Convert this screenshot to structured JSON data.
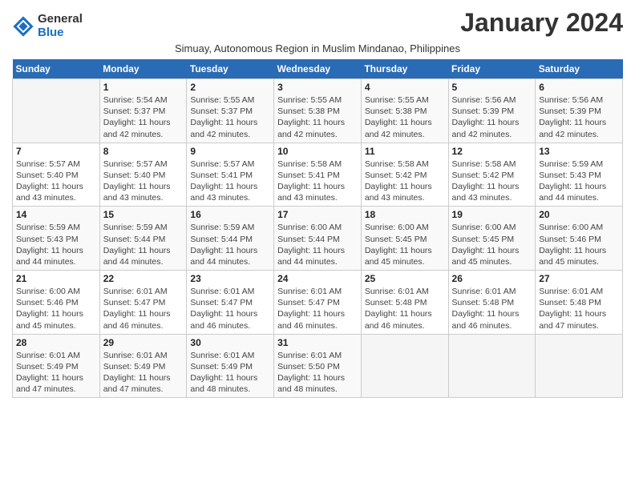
{
  "logo": {
    "general": "General",
    "blue": "Blue"
  },
  "title": "January 2024",
  "subtitle": "Simuay, Autonomous Region in Muslim Mindanao, Philippines",
  "header_days": [
    "Sunday",
    "Monday",
    "Tuesday",
    "Wednesday",
    "Thursday",
    "Friday",
    "Saturday"
  ],
  "weeks": [
    [
      {
        "day": "",
        "info": ""
      },
      {
        "day": "1",
        "info": "Sunrise: 5:54 AM\nSunset: 5:37 PM\nDaylight: 11 hours\nand 42 minutes."
      },
      {
        "day": "2",
        "info": "Sunrise: 5:55 AM\nSunset: 5:37 PM\nDaylight: 11 hours\nand 42 minutes."
      },
      {
        "day": "3",
        "info": "Sunrise: 5:55 AM\nSunset: 5:38 PM\nDaylight: 11 hours\nand 42 minutes."
      },
      {
        "day": "4",
        "info": "Sunrise: 5:55 AM\nSunset: 5:38 PM\nDaylight: 11 hours\nand 42 minutes."
      },
      {
        "day": "5",
        "info": "Sunrise: 5:56 AM\nSunset: 5:39 PM\nDaylight: 11 hours\nand 42 minutes."
      },
      {
        "day": "6",
        "info": "Sunrise: 5:56 AM\nSunset: 5:39 PM\nDaylight: 11 hours\nand 42 minutes."
      }
    ],
    [
      {
        "day": "7",
        "info": "Sunrise: 5:57 AM\nSunset: 5:40 PM\nDaylight: 11 hours\nand 43 minutes."
      },
      {
        "day": "8",
        "info": "Sunrise: 5:57 AM\nSunset: 5:40 PM\nDaylight: 11 hours\nand 43 minutes."
      },
      {
        "day": "9",
        "info": "Sunrise: 5:57 AM\nSunset: 5:41 PM\nDaylight: 11 hours\nand 43 minutes."
      },
      {
        "day": "10",
        "info": "Sunrise: 5:58 AM\nSunset: 5:41 PM\nDaylight: 11 hours\nand 43 minutes."
      },
      {
        "day": "11",
        "info": "Sunrise: 5:58 AM\nSunset: 5:42 PM\nDaylight: 11 hours\nand 43 minutes."
      },
      {
        "day": "12",
        "info": "Sunrise: 5:58 AM\nSunset: 5:42 PM\nDaylight: 11 hours\nand 43 minutes."
      },
      {
        "day": "13",
        "info": "Sunrise: 5:59 AM\nSunset: 5:43 PM\nDaylight: 11 hours\nand 44 minutes."
      }
    ],
    [
      {
        "day": "14",
        "info": "Sunrise: 5:59 AM\nSunset: 5:43 PM\nDaylight: 11 hours\nand 44 minutes."
      },
      {
        "day": "15",
        "info": "Sunrise: 5:59 AM\nSunset: 5:44 PM\nDaylight: 11 hours\nand 44 minutes."
      },
      {
        "day": "16",
        "info": "Sunrise: 5:59 AM\nSunset: 5:44 PM\nDaylight: 11 hours\nand 44 minutes."
      },
      {
        "day": "17",
        "info": "Sunrise: 6:00 AM\nSunset: 5:44 PM\nDaylight: 11 hours\nand 44 minutes."
      },
      {
        "day": "18",
        "info": "Sunrise: 6:00 AM\nSunset: 5:45 PM\nDaylight: 11 hours\nand 45 minutes."
      },
      {
        "day": "19",
        "info": "Sunrise: 6:00 AM\nSunset: 5:45 PM\nDaylight: 11 hours\nand 45 minutes."
      },
      {
        "day": "20",
        "info": "Sunrise: 6:00 AM\nSunset: 5:46 PM\nDaylight: 11 hours\nand 45 minutes."
      }
    ],
    [
      {
        "day": "21",
        "info": "Sunrise: 6:00 AM\nSunset: 5:46 PM\nDaylight: 11 hours\nand 45 minutes."
      },
      {
        "day": "22",
        "info": "Sunrise: 6:01 AM\nSunset: 5:47 PM\nDaylight: 11 hours\nand 46 minutes."
      },
      {
        "day": "23",
        "info": "Sunrise: 6:01 AM\nSunset: 5:47 PM\nDaylight: 11 hours\nand 46 minutes."
      },
      {
        "day": "24",
        "info": "Sunrise: 6:01 AM\nSunset: 5:47 PM\nDaylight: 11 hours\nand 46 minutes."
      },
      {
        "day": "25",
        "info": "Sunrise: 6:01 AM\nSunset: 5:48 PM\nDaylight: 11 hours\nand 46 minutes."
      },
      {
        "day": "26",
        "info": "Sunrise: 6:01 AM\nSunset: 5:48 PM\nDaylight: 11 hours\nand 46 minutes."
      },
      {
        "day": "27",
        "info": "Sunrise: 6:01 AM\nSunset: 5:48 PM\nDaylight: 11 hours\nand 47 minutes."
      }
    ],
    [
      {
        "day": "28",
        "info": "Sunrise: 6:01 AM\nSunset: 5:49 PM\nDaylight: 11 hours\nand 47 minutes."
      },
      {
        "day": "29",
        "info": "Sunrise: 6:01 AM\nSunset: 5:49 PM\nDaylight: 11 hours\nand 47 minutes."
      },
      {
        "day": "30",
        "info": "Sunrise: 6:01 AM\nSunset: 5:49 PM\nDaylight: 11 hours\nand 48 minutes."
      },
      {
        "day": "31",
        "info": "Sunrise: 6:01 AM\nSunset: 5:50 PM\nDaylight: 11 hours\nand 48 minutes."
      },
      {
        "day": "",
        "info": ""
      },
      {
        "day": "",
        "info": ""
      },
      {
        "day": "",
        "info": ""
      }
    ]
  ]
}
